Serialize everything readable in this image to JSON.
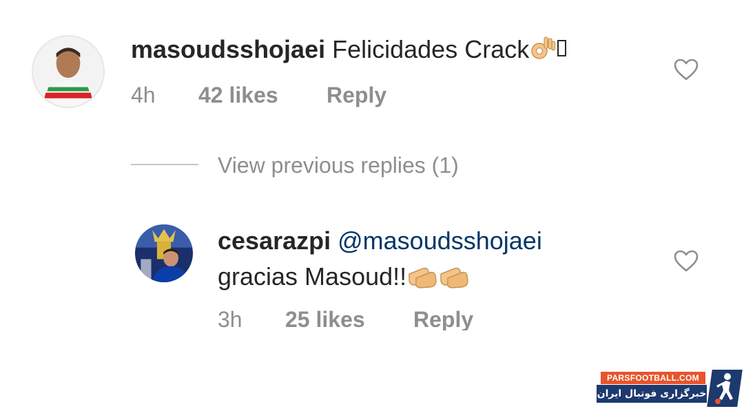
{
  "comments": [
    {
      "username": "masoudsshojaei",
      "text": "Felicidades Crack",
      "emojis": [
        "ok-hand"
      ],
      "time": "4h",
      "likes": "42 likes",
      "reply_label": "Reply"
    },
    {
      "username": "cesarazpi",
      "mention": "@masoudsshojaei",
      "text": "gracias Masoud!!",
      "emojis": [
        "clapping-hands",
        "clapping-hands"
      ],
      "time": "3h",
      "likes": "25 likes",
      "reply_label": "Reply"
    }
  ],
  "view_previous_replies": "View previous replies (1)",
  "watermark": {
    "top_text": "PARSFOOTBALL.COM",
    "bottom_text": "خبرگزاری فوتبال ایران"
  },
  "colors": {
    "username": "#262626",
    "meta": "#8e8e8e",
    "mention": "#003569",
    "logo_orange": "#e8542c",
    "logo_navy": "#1d3a6e"
  }
}
